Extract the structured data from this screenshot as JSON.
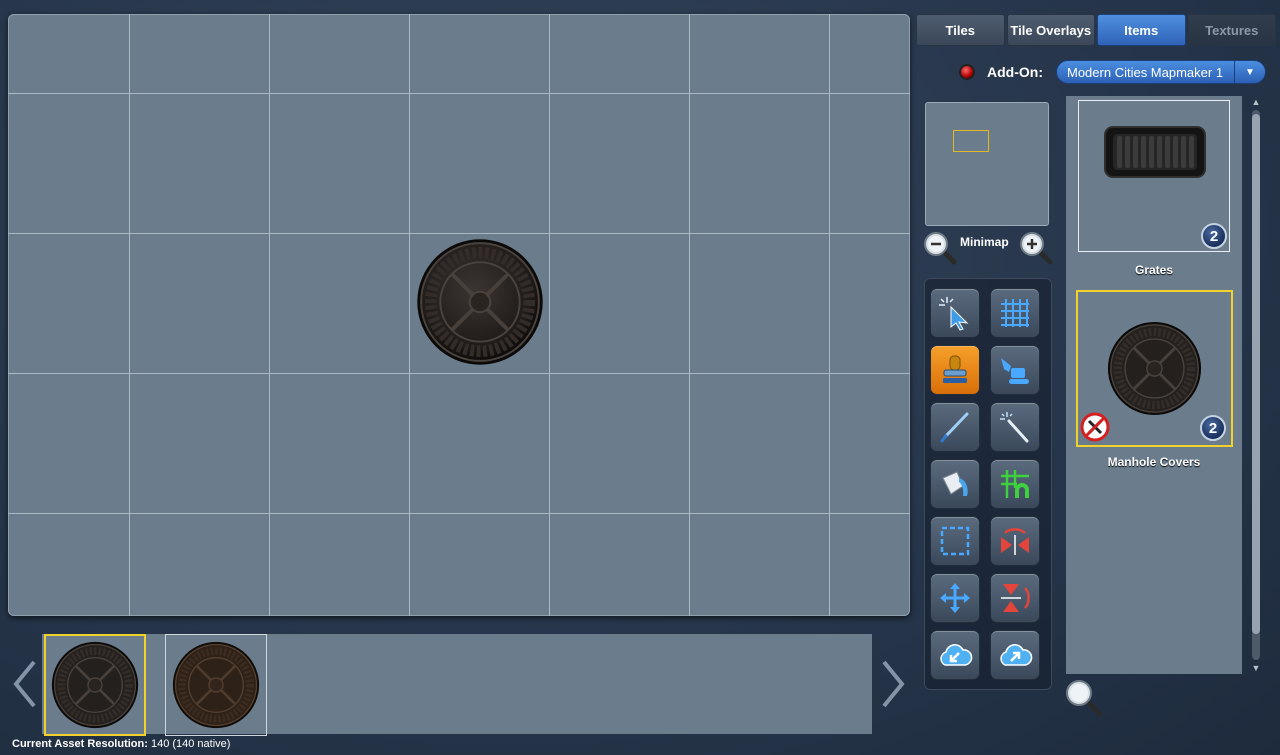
{
  "tabs": [
    {
      "label": "Tiles",
      "state": "normal"
    },
    {
      "label": "Tile Overlays",
      "state": "normal"
    },
    {
      "label": "Items",
      "state": "active"
    },
    {
      "label": "Textures",
      "state": "disabled"
    }
  ],
  "addon": {
    "label": "Add-On:",
    "selected": "Modern Cities Mapmaker 1"
  },
  "minimap": {
    "label": "Minimap"
  },
  "tools": [
    {
      "name": "select-tool-button",
      "icon": "pointer-icon",
      "active": false
    },
    {
      "name": "grid-tool-button",
      "icon": "grid-icon",
      "active": false
    },
    {
      "name": "stamp-tool-button",
      "icon": "stamp-icon",
      "active": true
    },
    {
      "name": "excavator-tool-button",
      "icon": "excavator-icon",
      "active": false
    },
    {
      "name": "brush-tool-button",
      "icon": "brush-icon",
      "active": false
    },
    {
      "name": "magic-wand-tool-button",
      "icon": "magic-wand-icon",
      "active": false
    },
    {
      "name": "fill-tool-button",
      "icon": "paint-bucket-icon",
      "active": false
    },
    {
      "name": "grid-snap-tool-button",
      "icon": "grid-magnet-icon",
      "active": false
    },
    {
      "name": "marquee-tool-button",
      "icon": "marquee-icon",
      "active": false
    },
    {
      "name": "flip-horizontal-tool-button",
      "icon": "flip-horizontal-icon",
      "active": false
    },
    {
      "name": "move-tool-button",
      "icon": "move-icon",
      "active": false
    },
    {
      "name": "flip-vertical-tool-button",
      "icon": "flip-vertical-icon",
      "active": false
    },
    {
      "name": "import-tool-button",
      "icon": "cloud-import-icon",
      "active": false
    },
    {
      "name": "export-tool-button",
      "icon": "cloud-export-icon",
      "active": false
    }
  ],
  "items": [
    {
      "label": "Grates",
      "count": "2",
      "selected": false,
      "icon": "grate-icon"
    },
    {
      "label": "Manhole Covers",
      "count": "2",
      "selected": true,
      "icon": "manhole-cover-icon",
      "restricted_icon": "no-symbol-icon"
    }
  ],
  "status": {
    "label": "Current Asset Resolution:",
    "value": "140 (140 native)"
  },
  "colors": {
    "accent": "#3b7bd6",
    "selection": "#f0d22a",
    "canvas": "#6b7d8d",
    "active_tool": "#f08a1c"
  }
}
